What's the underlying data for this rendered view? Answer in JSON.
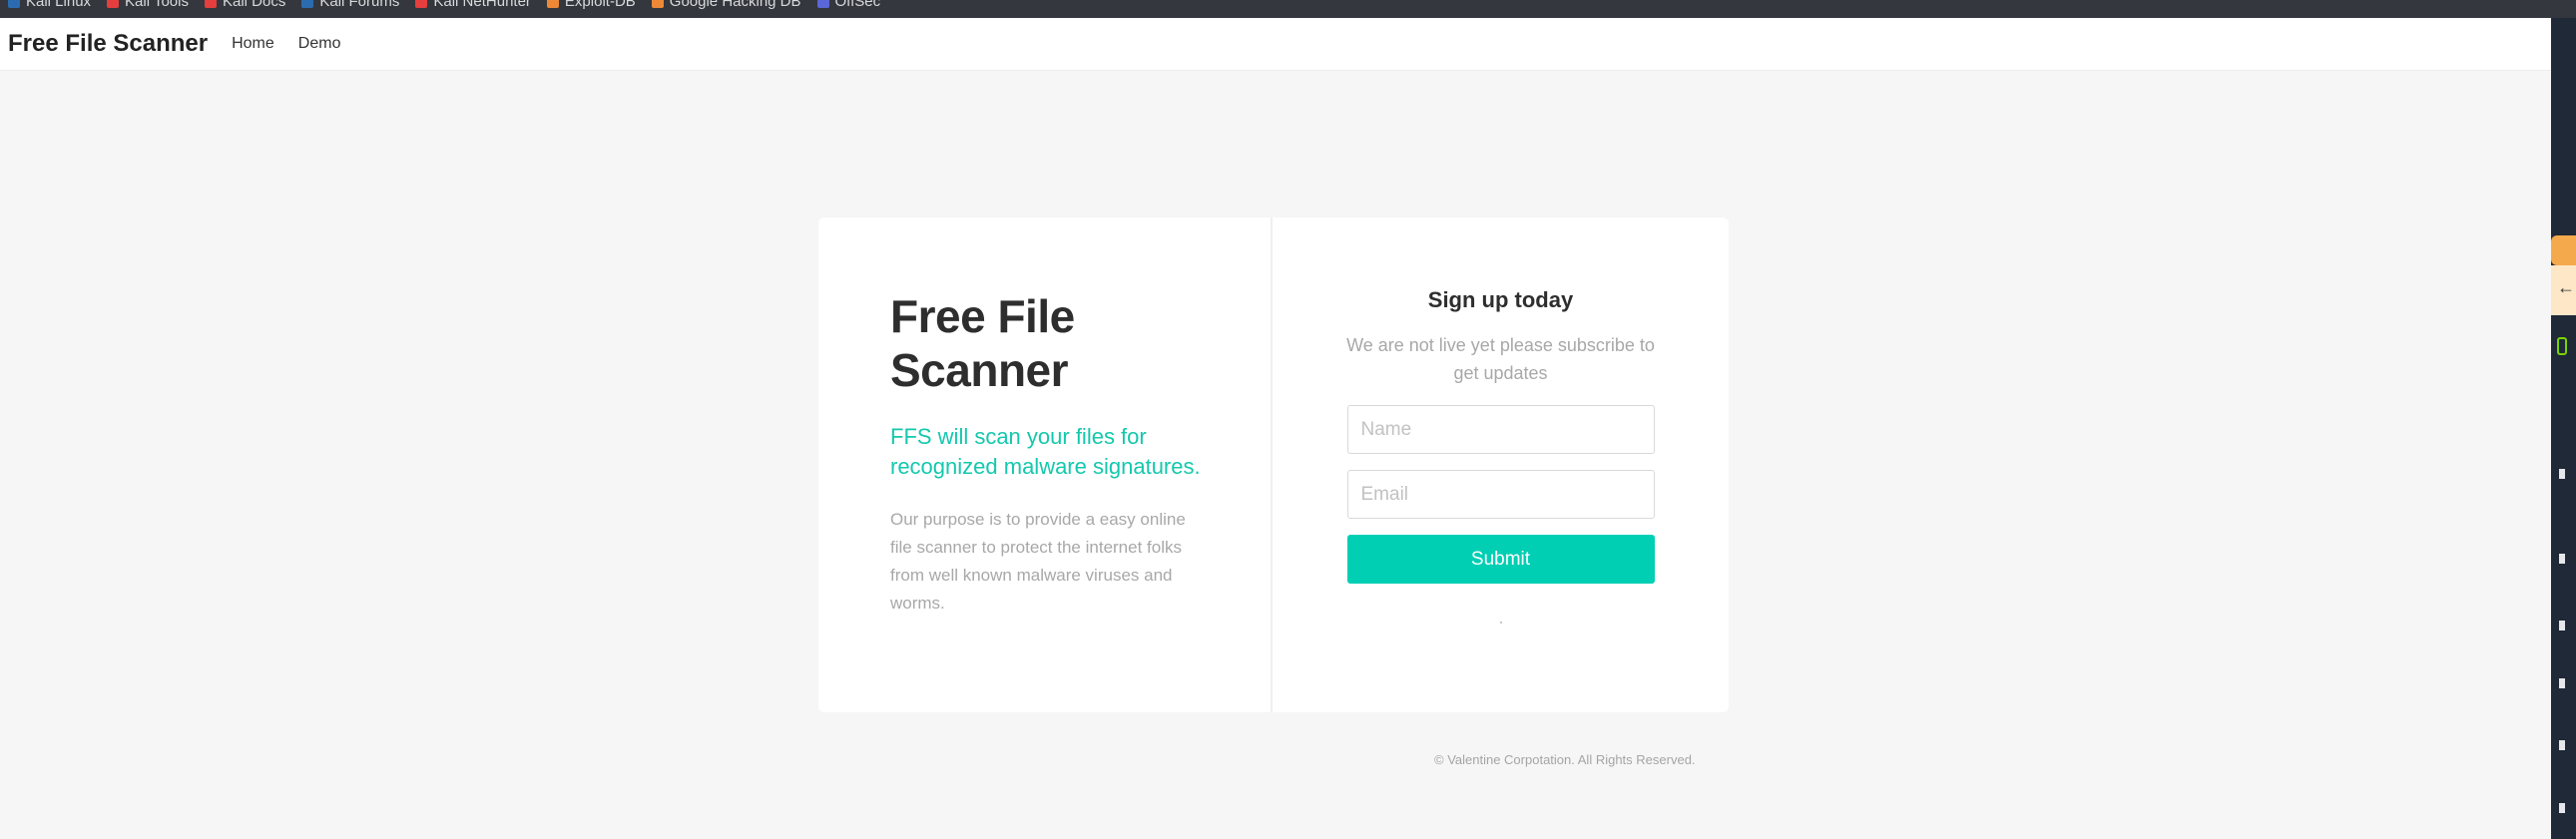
{
  "bookmarks": [
    {
      "label": "Kali Linux",
      "icon": "kali-icon",
      "color": "#2b6cb0"
    },
    {
      "label": "Kali Tools",
      "icon": "kali-tools-icon",
      "color": "#e53e3e"
    },
    {
      "label": "Kali Docs",
      "icon": "kali-docs-icon",
      "color": "#e53e3e"
    },
    {
      "label": "Kali Forums",
      "icon": "kali-forums-icon",
      "color": "#2b6cb0"
    },
    {
      "label": "Kali NetHunter",
      "icon": "nethunter-icon",
      "color": "#e53e3e"
    },
    {
      "label": "Exploit-DB",
      "icon": "exploit-db-icon",
      "color": "#ed8936"
    },
    {
      "label": "Google Hacking DB",
      "icon": "ghdb-icon",
      "color": "#ed8936"
    },
    {
      "label": "OffSec",
      "icon": "offsec-icon",
      "color": "#5a67d8"
    }
  ],
  "navbar": {
    "brand": "Free File Scanner",
    "links": [
      "Home",
      "Demo"
    ]
  },
  "hero": {
    "title": "Free File Scanner",
    "tagline": "FFS will scan your files for recognized malware signatures.",
    "description": "Our purpose is to provide a easy online file scanner to protect the internet folks from well known malware viruses and worms."
  },
  "signup": {
    "title": "Sign up today",
    "subtitle": "We are not live yet please subscribe to get updates",
    "name_placeholder": "Name",
    "email_placeholder": "Email",
    "submit_label": "Submit"
  },
  "footer": {
    "text": "© Valentine Corpotation. All Rights Reserved."
  },
  "colors": {
    "accent": "#00cfb4",
    "tagline": "#14c8ad",
    "background": "#f6f6f6"
  }
}
